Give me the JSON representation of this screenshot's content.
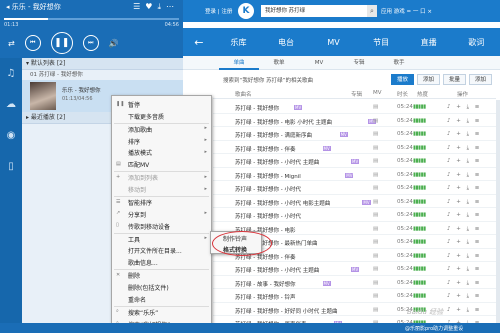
{
  "app": {
    "title": "乐乐 - 我好想你"
  },
  "now_playing": {
    "time_elapsed": "01:13",
    "time_total": "04:56",
    "progress": 0.25
  },
  "sidebar": {
    "groups": [
      "默认列表 [2]",
      "最近播放 [2]"
    ],
    "items": [
      {
        "label": "01 苏打绿 - 我好想你"
      },
      {
        "label": "02 乐乐 - 我好想你"
      }
    ],
    "selected": {
      "title": "乐乐 - 我好想你",
      "meta": "01:13/04:56"
    },
    "icons": [
      "music-note-icon",
      "cloud-icon",
      "radio-icon",
      "phone-icon"
    ]
  },
  "title_bar": {
    "login": "登录 | 注册",
    "search_value": "我好想你 苏打绿",
    "right_items": "应用 游戏 = 一 口 ×"
  },
  "nav": {
    "back": "←",
    "tabs": [
      "乐库",
      "电台",
      "MV",
      "节目",
      "直播",
      "歌词"
    ]
  },
  "subtabs": [
    "单曲",
    "歌单",
    "MV",
    "专辑",
    "歌手"
  ],
  "results": {
    "text": "搜索到“我好想你 苏打绿”的相关歌曲",
    "actions": [
      "播放",
      "添加",
      "批量",
      "添加"
    ]
  },
  "table": {
    "headers": [
      "歌曲名",
      "专辑",
      "MV",
      "时长",
      "热度",
      "操作"
    ],
    "rows": [
      {
        "title": "苏打绿 - 我好想你",
        "tag": "MV",
        "dur": "05:24"
      },
      {
        "title": "苏打绿 - 我好想你 - 电影 小时代 主题曲",
        "tag": "MV",
        "dur": "05:24"
      },
      {
        "title": "苏打绿 - 我好想你 - 满庭新序曲",
        "tag": "MV",
        "dur": "05:24"
      },
      {
        "title": "苏打绿 - 我好想你 - 伴奏",
        "tag": "MV",
        "dur": "05:24"
      },
      {
        "title": "苏打绿 - 我好想你 - 小时代 主题曲",
        "tag": "MV",
        "dur": "05:24"
      },
      {
        "title": "苏打绿 - 我好想你 - Mignil",
        "tag": "MV",
        "dur": "05:24"
      },
      {
        "title": "苏打绿 - 我好想你 - 小时代",
        "tag": "",
        "dur": "05:24"
      },
      {
        "title": "苏打绿 - 我好想你 - 小时代 电影主题曲",
        "tag": "MV",
        "dur": "05:24"
      },
      {
        "title": "苏打绿 - 我好想你 - 小时代",
        "tag": "",
        "dur": "05:24"
      },
      {
        "title": "苏打绿 - 我好想你 - 电影",
        "tag": "",
        "dur": "05:24"
      },
      {
        "title": "苏打绿 - 我好想你 - 最新热门单曲",
        "tag": "",
        "dur": "05:24"
      },
      {
        "title": "苏打绿 - 我好想你 - 伴奏",
        "tag": "",
        "dur": "05:24"
      },
      {
        "title": "苏打绿 - 我好想你 - 小时代 主题曲",
        "tag": "MV",
        "dur": "05:24"
      },
      {
        "title": "苏打绿 - 故事 - 我好想你",
        "tag": "MV",
        "dur": "05:24"
      },
      {
        "title": "苏打绿 - 我好想你 - 铃声",
        "tag": "",
        "dur": "05:24"
      },
      {
        "title": "苏打绿 - 我好想你 - 好好同 小时代 主题曲",
        "tag": "",
        "dur": "05:24"
      },
      {
        "title": "苏打绿 - 我好想你 - 原声伴奏",
        "tag": "MV",
        "dur": "05:24"
      }
    ]
  },
  "context_menu": {
    "items": [
      {
        "label": "暂停",
        "disabled": false,
        "submenu": false
      },
      {
        "label": "下载更多音质",
        "disabled": false,
        "submenu": false
      },
      {
        "label": "添加歌曲",
        "disabled": false,
        "submenu": true
      },
      {
        "label": "排序",
        "disabled": false,
        "submenu": true
      },
      {
        "label": "播放模式",
        "disabled": false,
        "submenu": true
      },
      {
        "label": "匹配MV",
        "disabled": false,
        "submenu": false
      },
      {
        "label": "添加到列表",
        "disabled": true,
        "submenu": true
      },
      {
        "label": "移动到",
        "disabled": true,
        "submenu": true
      },
      {
        "label": "智能排序",
        "disabled": false,
        "submenu": false
      },
      {
        "label": "分享到",
        "disabled": false,
        "submenu": true
      },
      {
        "label": "传歌到移动设备",
        "disabled": false,
        "submenu": false
      },
      {
        "label": "工具",
        "disabled": false,
        "submenu": true
      },
      {
        "label": "打开文件所在目录...",
        "disabled": false,
        "submenu": false
      },
      {
        "label": "歌曲信息...",
        "disabled": false,
        "submenu": false
      },
      {
        "label": "删除",
        "disabled": false,
        "submenu": false
      },
      {
        "label": "删除(包括文件)",
        "disabled": false,
        "submenu": false
      },
      {
        "label": "重命名",
        "disabled": false,
        "submenu": false
      },
      {
        "label": "搜索“乐乐”",
        "disabled": false,
        "submenu": false
      },
      {
        "label": "搜索“我好想你”",
        "disabled": false,
        "submenu": false
      }
    ],
    "submenu": [
      "制作铃声",
      "格式转换"
    ]
  },
  "status_bar": {
    "text": "@乐丽影pro助力调整重设"
  },
  "watermark": "Baidu 经验"
}
